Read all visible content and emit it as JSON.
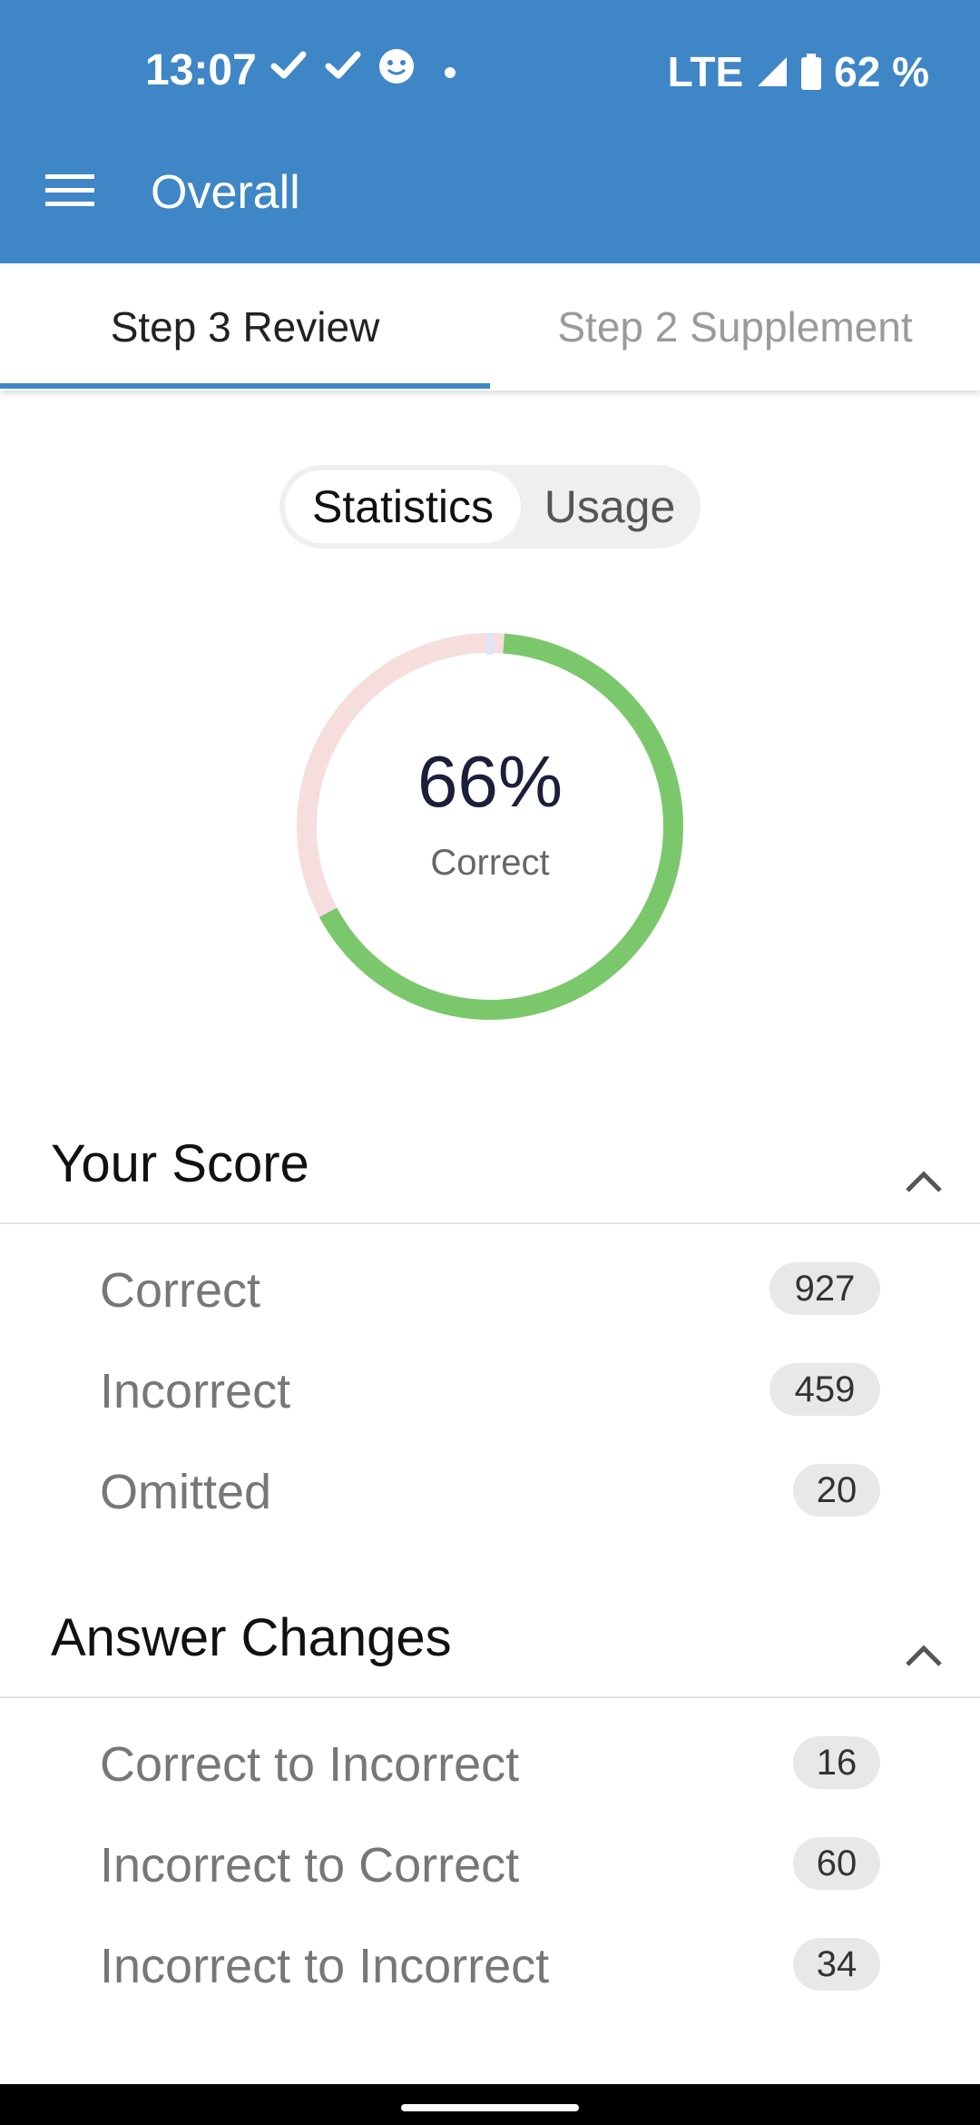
{
  "status_bar": {
    "time": "13:07",
    "network": "LTE",
    "battery": "62 %"
  },
  "toolbar": {
    "title": "Overall"
  },
  "tabs": [
    {
      "label": "Step 3 Review",
      "active": true
    },
    {
      "label": "Step 2 Supplement",
      "active": false
    }
  ],
  "segments": [
    {
      "label": "Statistics",
      "active": true
    },
    {
      "label": "Usage",
      "active": false
    }
  ],
  "donut": {
    "percent_text": "66%",
    "label": "Correct",
    "correct_fraction": 0.66,
    "correct_color": "#7bc86c",
    "incorrect_color": "#f6dede",
    "omitted_color": "#dfe6f7"
  },
  "your_score": {
    "title": "Your Score",
    "rows": [
      {
        "label": "Correct",
        "value": "927"
      },
      {
        "label": "Incorrect",
        "value": "459"
      },
      {
        "label": "Omitted",
        "value": "20"
      }
    ]
  },
  "answer_changes": {
    "title": "Answer Changes",
    "rows": [
      {
        "label": "Correct to Incorrect",
        "value": "16"
      },
      {
        "label": "Incorrect to Correct",
        "value": "60"
      },
      {
        "label": "Incorrect to Incorrect",
        "value": "34"
      }
    ]
  },
  "icons": {
    "menu": "hamburger-menu-icon",
    "collapse": "chevron-up-icon"
  }
}
